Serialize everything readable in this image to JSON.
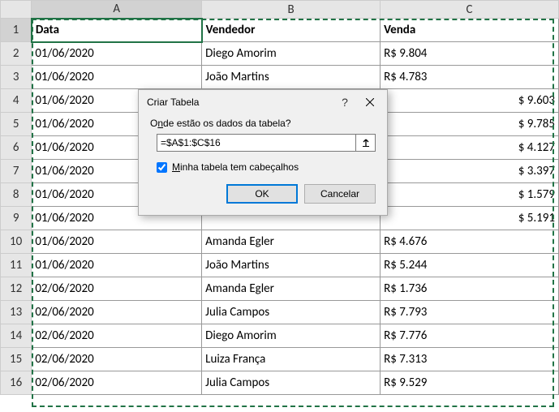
{
  "columns": [
    "A",
    "B",
    "C"
  ],
  "headers": {
    "a": "Data",
    "b": "Vendedor",
    "c": "Venda"
  },
  "rows": [
    {
      "n": "1"
    },
    {
      "n": "2",
      "a": "01/06/2020",
      "b": "Diego Amorim",
      "c": "R$ 9.804"
    },
    {
      "n": "3",
      "a": "01/06/2020",
      "b": "João Martins",
      "c": "R$ 4.783"
    },
    {
      "n": "4",
      "a": "01/06/2020",
      "b": "",
      "c": "$ 9.603"
    },
    {
      "n": "5",
      "a": "01/06/2020",
      "b": "",
      "c": "$ 9.785"
    },
    {
      "n": "6",
      "a": "01/06/2020",
      "b": "",
      "c": "$ 4.127"
    },
    {
      "n": "7",
      "a": "01/06/2020",
      "b": "",
      "c": "$ 3.397"
    },
    {
      "n": "8",
      "a": "01/06/2020",
      "b": "",
      "c": "$ 1.579"
    },
    {
      "n": "9",
      "a": "01/06/2020",
      "b": "",
      "c": "$ 5.191"
    },
    {
      "n": "10",
      "a": "01/06/2020",
      "b": "Amanda Egler",
      "c": "R$ 4.676"
    },
    {
      "n": "11",
      "a": "01/06/2020",
      "b": "João Martins",
      "c": "R$ 5.244"
    },
    {
      "n": "12",
      "a": "02/06/2020",
      "b": "Amanda Egler",
      "c": "R$ 1.736"
    },
    {
      "n": "13",
      "a": "02/06/2020",
      "b": "Julia Campos",
      "c": "R$ 7.793"
    },
    {
      "n": "14",
      "a": "02/06/2020",
      "b": "Diego Amorim",
      "c": "R$ 7.776"
    },
    {
      "n": "15",
      "a": "02/06/2020",
      "b": "Luiza França",
      "c": "R$ 7.313"
    },
    {
      "n": "16",
      "a": "02/06/2020",
      "b": "Julia Campos",
      "c": "R$ 9.529"
    }
  ],
  "dialog": {
    "title": "Criar Tabela",
    "prompt_pre": "O",
    "prompt_u": "n",
    "prompt_post": "de estão os dados da tabela?",
    "range": "=$A$1:$C$16",
    "checkbox_pre": "",
    "checkbox_u": "M",
    "checkbox_post": "inha tabela tem cabeçalhos",
    "ok": "OK",
    "cancel": "Cancelar",
    "help": "?"
  }
}
